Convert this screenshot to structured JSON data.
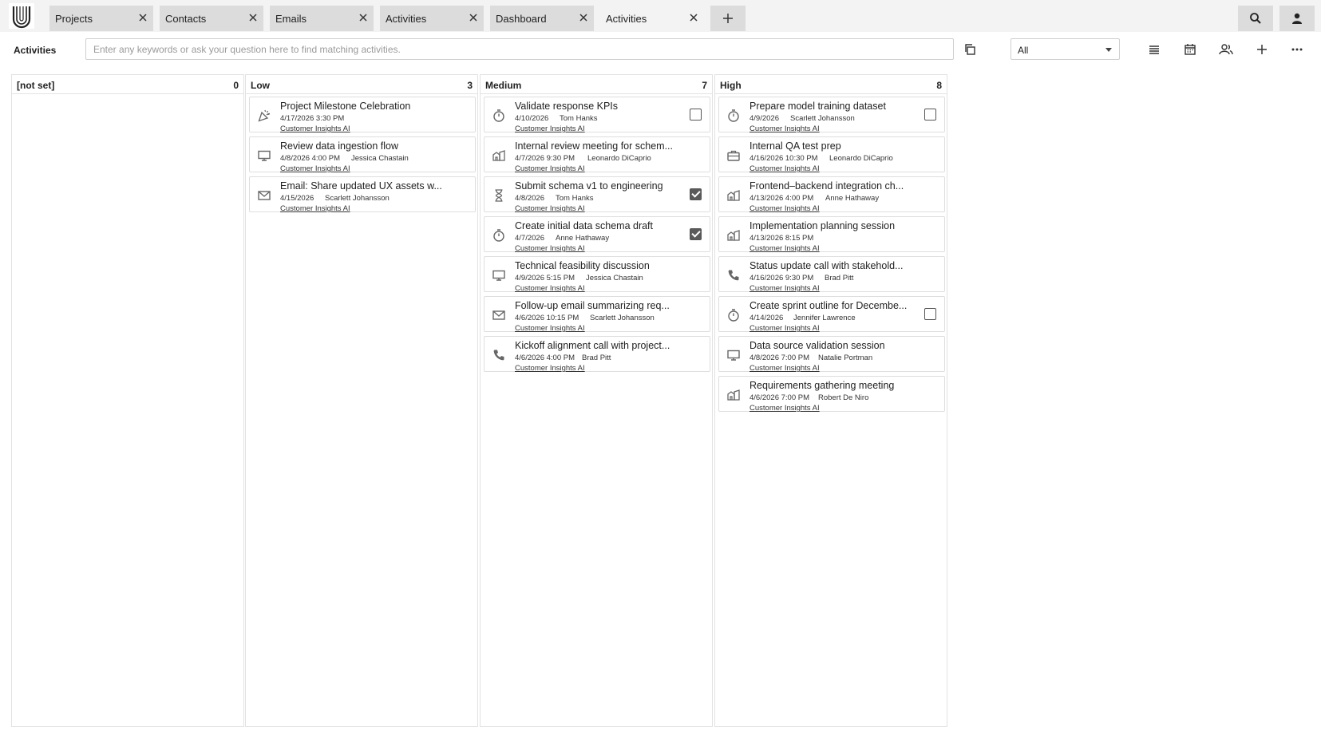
{
  "tabs": [
    {
      "label": "Projects"
    },
    {
      "label": "Contacts"
    },
    {
      "label": "Emails"
    },
    {
      "label": "Activities"
    },
    {
      "label": "Dashboard"
    },
    {
      "label": "Activities",
      "active": true
    }
  ],
  "toolbar": {
    "title": "Activities",
    "search_placeholder": "Enter any keywords or ask your question here to find matching activities.",
    "filter_value": "All"
  },
  "columns": [
    {
      "name": "[not set]",
      "count": "0",
      "cards": []
    },
    {
      "name": "Low",
      "count": "3",
      "cards": [
        {
          "icon": "celebration-icon",
          "title": "Project Milestone Celebration",
          "date": "4/17/2026 3:30 PM",
          "person": "",
          "project": "Customer Insights AI",
          "checkbox": null
        },
        {
          "icon": "monitor-icon",
          "title": "Review data ingestion flow",
          "date": "4/8/2026 4:00 PM",
          "person": "Jessica Chastain",
          "project": "Customer Insights AI",
          "checkbox": null
        },
        {
          "icon": "email-icon",
          "title": "Email: Share updated UX assets w...",
          "date": "4/15/2026",
          "person": "Scarlett Johansson",
          "project": "Customer Insights AI",
          "checkbox": null
        }
      ]
    },
    {
      "name": "Medium",
      "count": "7",
      "cards": [
        {
          "icon": "timer-icon",
          "title": "Validate response KPIs",
          "date": "4/10/2026",
          "person": "Tom Hanks",
          "project": "Customer Insights AI",
          "checkbox": false
        },
        {
          "icon": "meeting-icon",
          "title": "Internal review meeting for schem...",
          "date": "4/7/2026 9:30 PM",
          "person": "Leonardo DiCaprio",
          "project": "Customer Insights AI",
          "checkbox": null
        },
        {
          "icon": "hourglass-icon",
          "title": "Submit schema v1 to engineering",
          "date": "4/8/2026",
          "person": "Tom Hanks",
          "project": "Customer Insights AI",
          "checkbox": true
        },
        {
          "icon": "timer-icon",
          "title": "Create initial data schema draft",
          "date": "4/7/2026",
          "person": "Anne Hathaway",
          "project": "Customer Insights AI",
          "checkbox": true
        },
        {
          "icon": "monitor-icon",
          "title": "Technical feasibility discussion",
          "date": "4/9/2026 5:15 PM",
          "person": "Jessica Chastain",
          "project": "Customer Insights AI",
          "checkbox": null
        },
        {
          "icon": "email-icon",
          "title": "Follow-up email summarizing req...",
          "date": "4/6/2026 10:15 PM",
          "person": "Scarlett Johansson",
          "project": "Customer Insights AI",
          "checkbox": null
        },
        {
          "icon": "phone-icon",
          "title": "Kickoff alignment call with project...",
          "date": "4/6/2026 4:00 PM",
          "person": "Brad Pitt",
          "project": "Customer Insights AI",
          "checkbox": null
        }
      ]
    },
    {
      "name": "High",
      "count": "8",
      "cards": [
        {
          "icon": "timer-icon",
          "title": "Prepare model training dataset",
          "date": "4/9/2026",
          "person": "Scarlett Johansson",
          "project": "Customer Insights AI",
          "checkbox": false
        },
        {
          "icon": "briefcase-icon",
          "title": "Internal QA test prep",
          "date": "4/16/2026 10:30 PM",
          "person": "Leonardo DiCaprio",
          "project": "Customer Insights AI",
          "checkbox": null
        },
        {
          "icon": "meeting-icon",
          "title": "Frontend–backend integration ch...",
          "date": "4/13/2026 4:00 PM",
          "person": "Anne Hathaway",
          "project": "Customer Insights AI",
          "checkbox": null
        },
        {
          "icon": "meeting-icon",
          "title": "Implementation planning session",
          "date": "4/13/2026 8:15 PM",
          "person": "",
          "project": "Customer Insights AI",
          "checkbox": null
        },
        {
          "icon": "phone-icon",
          "title": "Status update call with stakehold...",
          "date": "4/16/2026 9:30 PM",
          "person": "Brad Pitt",
          "project": "Customer Insights AI",
          "checkbox": null
        },
        {
          "icon": "timer-icon",
          "title": "Create sprint outline for Decembe...",
          "date": "4/14/2026",
          "person": "Jennifer Lawrence",
          "project": "Customer Insights AI",
          "checkbox": false
        },
        {
          "icon": "monitor-icon",
          "title": "Data source validation session",
          "date": "4/8/2026 7:00 PM",
          "person": "Natalie Portman",
          "project": "Customer Insights AI",
          "checkbox": null
        },
        {
          "icon": "meeting-icon",
          "title": "Requirements gathering meeting",
          "date": "4/6/2026 7:00 PM",
          "person": "Robert De Niro",
          "project": "Customer Insights AI",
          "checkbox": null
        }
      ]
    }
  ]
}
